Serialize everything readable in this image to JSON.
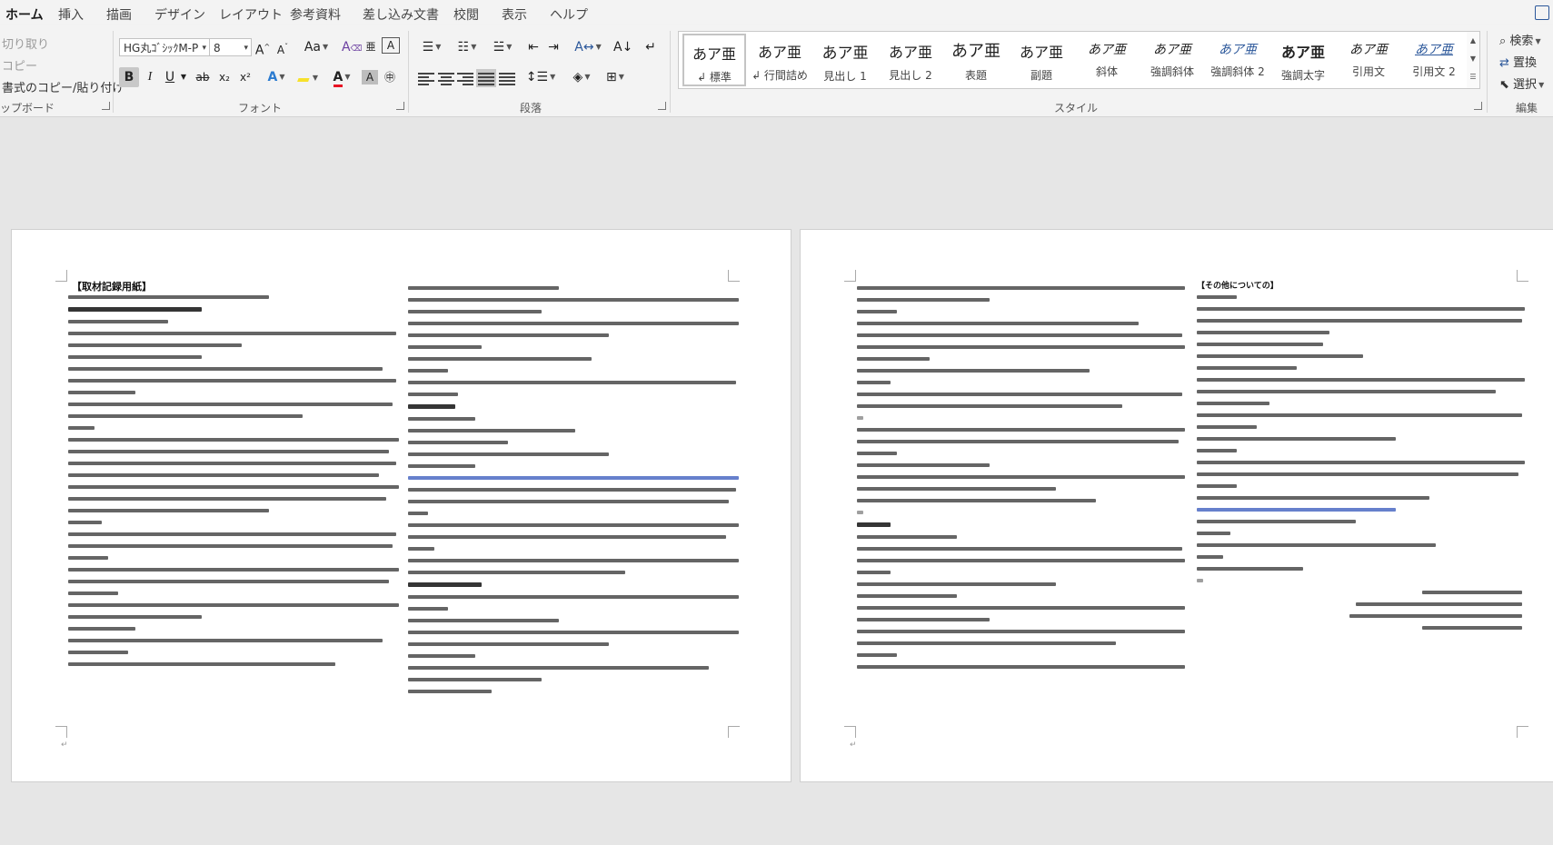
{
  "tabs": [
    {
      "label": "ホーム",
      "active": true
    },
    {
      "label": "挿入"
    },
    {
      "label": "描画"
    },
    {
      "label": "デザイン"
    },
    {
      "label": "レイアウト"
    },
    {
      "label": "参考資料"
    },
    {
      "label": "差し込み文書"
    },
    {
      "label": "校閲"
    },
    {
      "label": "表示"
    },
    {
      "label": "ヘルプ"
    }
  ],
  "clipboard": {
    "cut": "切り取り",
    "copy": "コピー",
    "format_painter": "書式のコピー/貼り付け",
    "group_label": "ップボード"
  },
  "font": {
    "name": "HG丸ｺﾞｼｯｸM-P",
    "size": "8",
    "change_case": "Aa",
    "bold": "B",
    "italic": "I",
    "underline": "U",
    "strike": "ab",
    "subscript": "x₂",
    "superscript": "x²",
    "text_effects": "A",
    "font_color": "A",
    "char_shading": "A",
    "enclosed_char": "字",
    "grow": "A^",
    "shrink": "Aˇ",
    "clear_format": "A",
    "phonetic": "亜",
    "char_border": "A",
    "group_label": "フォント",
    "highlight_color": "#f7e12b",
    "font_color_value": "#e81123"
  },
  "paragraph": {
    "group_label": "段落"
  },
  "styles": {
    "group_label": "スタイル",
    "items": [
      {
        "sample": "あア亜",
        "name": "↲ 標準",
        "selected": true
      },
      {
        "sample": "あア亜",
        "name": "↲ 行間詰め"
      },
      {
        "sample": "あア亜",
        "name": "見出し 1"
      },
      {
        "sample": "あア亜",
        "name": "見出し 2"
      },
      {
        "sample": "あア亜",
        "name": "表題"
      },
      {
        "sample": "あア亜",
        "name": "副題"
      },
      {
        "sample": "あア亜",
        "name": "斜体"
      },
      {
        "sample": "あア亜",
        "name": "強調斜体"
      },
      {
        "sample": "あア亜",
        "name": "強調斜体 2"
      },
      {
        "sample": "あア亜",
        "name": "強調太字"
      },
      {
        "sample": "あア亜",
        "name": "引用文"
      },
      {
        "sample": "あア亜",
        "name": "引用文 2"
      }
    ]
  },
  "editing": {
    "find": "検索",
    "replace": "置換",
    "select": "選択",
    "group_label": "編集"
  },
  "document": {
    "page1_heading": "【取材記録用紙】",
    "page2_heading_right": "【その他についての】"
  }
}
